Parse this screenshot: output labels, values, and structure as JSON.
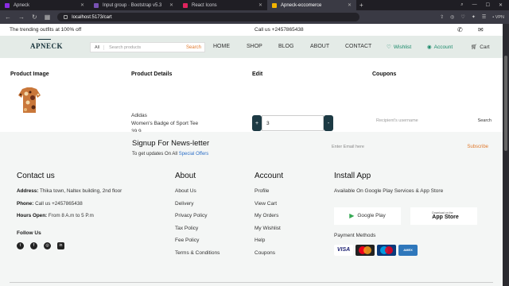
{
  "browser": {
    "tabs": [
      {
        "title": "Apneck",
        "color": "#8a2be2",
        "active": false
      },
      {
        "title": "Input group · Bootstrap v5.3",
        "color": "#7952b3",
        "active": false
      },
      {
        "title": "React Icons",
        "color": "#e0245e",
        "active": false
      },
      {
        "title": "Apneck-eccomerce",
        "color": "#f4b400",
        "active": true
      }
    ],
    "new_tab": "+",
    "url": "localhost:5173/cart",
    "vpn": "• VPN"
  },
  "topstrip": {
    "promo": "The trending outfits at 100% off",
    "phone": "Call us +2457865438"
  },
  "header": {
    "logo": "APNECK",
    "search": {
      "category": "All",
      "placeholder": "Search products",
      "button": "Search"
    },
    "nav": [
      "HOME",
      "SHOP",
      "BLOG",
      "ABOUT",
      "CONTACT"
    ],
    "wishlist": "Wishlist",
    "account": "Account",
    "cart": "Cart"
  },
  "cart": {
    "headers": {
      "image": "Product Image",
      "details": "Product Details",
      "edit": "Edit",
      "coupons": "Coupons"
    },
    "product": {
      "brand": "Adidas",
      "name": "Women's Badge of Sport Tee",
      "price": "39,9"
    },
    "quantity": {
      "minus": "+",
      "value": "3",
      "plus": "-"
    },
    "coupon": {
      "placeholder": "Recipient's username",
      "button": "Search"
    }
  },
  "newsletter": {
    "title": "Signup For News-letter",
    "subtitle_prefix": "To get updates On All ",
    "subtitle_link": "Special Offers",
    "email_placeholder": "Enter Email here",
    "subscribe": "Subscribe"
  },
  "footer": {
    "contact": {
      "title": "Contact us",
      "address_label": "Address:",
      "address": "Thika town, Naltex building, 2nd floor",
      "phone_label": "Phone:",
      "phone": "Call us +2457865438",
      "hours_label": "Hours Open:",
      "hours": "From 8 A.m to 5 P.m",
      "follow": "Follow Us"
    },
    "about": {
      "title": "About",
      "links": [
        "About Us",
        "Delivery",
        "Privacy Policy",
        "Tax Policy",
        "Fee Policy",
        "Terms & Conditions"
      ]
    },
    "account": {
      "title": "Account",
      "links": [
        "Profile",
        "View Cart",
        "My Orders",
        "My Wishlist",
        "Help",
        "Coupons"
      ]
    },
    "install": {
      "title": "Install App",
      "subtitle": "Available On Google Play Services & App Store",
      "google_play": "Google Play",
      "app_store_small": "Download on the",
      "app_store": "App Store",
      "payment_title": "Payment Methods",
      "cards": [
        "VISA",
        "Master",
        "Maestro",
        "AmEx"
      ]
    }
  }
}
